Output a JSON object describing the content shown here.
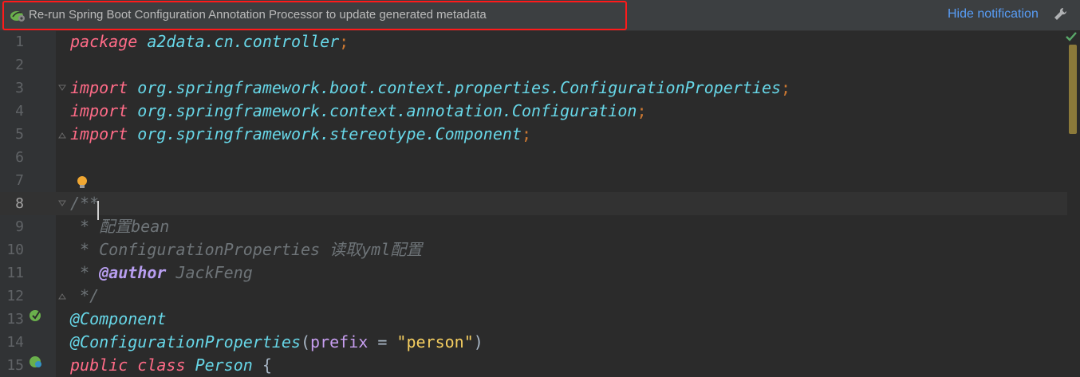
{
  "notification": {
    "message": "Re-run Spring Boot Configuration Annotation Processor to update generated metadata",
    "hide_label": "Hide notification"
  },
  "editor": {
    "line_numbers": [
      "1",
      "2",
      "3",
      "4",
      "5",
      "6",
      "7",
      "8",
      "9",
      "10",
      "11",
      "12",
      "13",
      "14",
      "15"
    ],
    "current_line": "8",
    "code": {
      "l1_kw": "package",
      "l1_pkg": "a2data.cn.controller",
      "semi": ";",
      "import_kw": "import",
      "l3_pkg": "org.springframework.boot.context.properties.ConfigurationProperties",
      "l4_pkg": "org.springframework.context.annotation.Configuration",
      "l5_pkg": "org.springframework.stereotype.Component",
      "l8_cmt": "/**",
      "l9_cmt": " * 配置bean",
      "l10_cmt": " * ConfigurationProperties 读取yml配置",
      "l11_cmt_prefix": " * ",
      "l11_tag": "@author",
      "l11_cmt_suffix": " JackFeng",
      "l12_cmt": " */",
      "l13_ann": "@Component",
      "l14_ann": "@ConfigurationProperties",
      "l14_paren_open": "(",
      "l14_attr": "prefix",
      "l14_eq": " = ",
      "l14_str": "\"person\"",
      "l14_paren_close": ")",
      "l15_public": "public",
      "l15_class": "class",
      "l15_name": "Person",
      "l15_brace": " {"
    }
  },
  "colors": {
    "notification_border": "#ff1a1a",
    "link": "#589df6",
    "scroll_marker": "#8c7a3a"
  },
  "icons": [
    "spring-boot-icon",
    "wrench-icon",
    "check-icon",
    "lightbulb-icon",
    "spring-bean-icon",
    "fold-marker-icon"
  ]
}
